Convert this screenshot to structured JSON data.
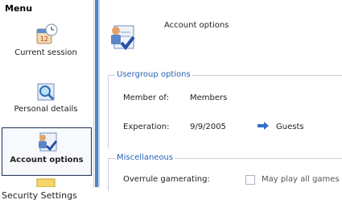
{
  "sidebar": {
    "title": "Menu",
    "items": [
      {
        "label": "Current session",
        "icon": "calendar-clock-icon",
        "selected": false
      },
      {
        "label": "Personal details",
        "icon": "magnifier-document-icon",
        "selected": false
      },
      {
        "label": "Account options",
        "icon": "account-checkmark-icon",
        "selected": true
      }
    ]
  },
  "header": {
    "title": "Account options",
    "icon": "account-checkmark-icon"
  },
  "usergroup": {
    "legend": "Usergroup options",
    "member_label": "Member of:",
    "member_value": "Members",
    "expiration_label": "Experation:",
    "expiration_value": "9/9/2005",
    "next_group": "Guests",
    "arrow_icon": "right-arrow-icon"
  },
  "misc": {
    "legend": "Miscellaneous",
    "gamerating_label": "Overrule gamerating:",
    "checkbox_label": "May play all games",
    "checked": false
  },
  "caption": "Security Settings",
  "colors": {
    "accent": "#2a64b5",
    "divider": "#4e86c6",
    "selected_border": "#1f2f5a",
    "arrow": "#2e6fcf"
  }
}
